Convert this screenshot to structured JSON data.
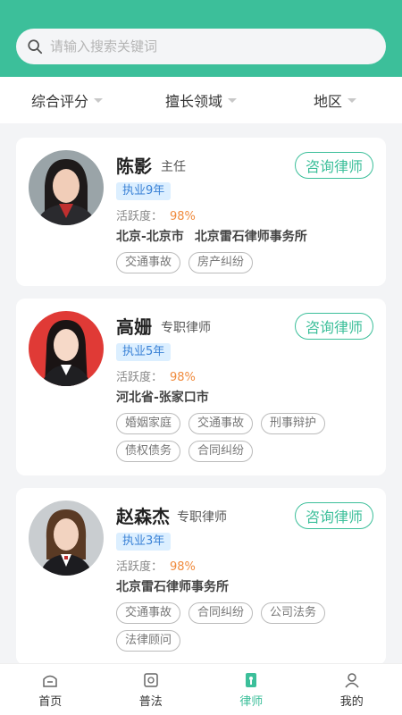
{
  "search": {
    "placeholder": "请输入搜索关键词",
    "icon": "search-icon"
  },
  "filters": [
    {
      "label": "综合评分"
    },
    {
      "label": "擅长领域"
    },
    {
      "label": "地区"
    }
  ],
  "lawyers": [
    {
      "name": "陈影",
      "title": "主任",
      "years": "执业9年",
      "activity_label": "活跃度：",
      "activity_value": "98%",
      "location": "北京-北京市",
      "firm": "北京雷石律师事务所",
      "consult_label": "咨询律师",
      "tags": [
        "交通事故",
        "房产纠纷"
      ]
    },
    {
      "name": "高姗",
      "title": "专职律师",
      "years": "执业5年",
      "activity_label": "活跃度：",
      "activity_value": "98%",
      "location": "河北省-张家口市",
      "firm": "",
      "consult_label": "咨询律师",
      "tags": [
        "婚姻家庭",
        "交通事故",
        "刑事辩护",
        "债权债务",
        "合同纠纷"
      ]
    },
    {
      "name": "赵森杰",
      "title": "专职律师",
      "years": "执业3年",
      "activity_label": "活跃度：",
      "activity_value": "98%",
      "location": "北京雷石律师事务所",
      "firm": "",
      "consult_label": "咨询律师",
      "tags": [
        "交通事故",
        "合同纠纷",
        "公司法务",
        "法律顾问"
      ]
    }
  ],
  "tabbar": [
    {
      "label": "首页",
      "icon": "home-icon"
    },
    {
      "label": "普法",
      "icon": "law-book-icon"
    },
    {
      "label": "律师",
      "icon": "lawyer-icon",
      "active": true
    },
    {
      "label": "我的",
      "icon": "user-icon"
    }
  ],
  "colors": {
    "brand": "#3cbf9a",
    "accent_orange": "#f08a3c",
    "badge_blue": "#3a82d6"
  }
}
